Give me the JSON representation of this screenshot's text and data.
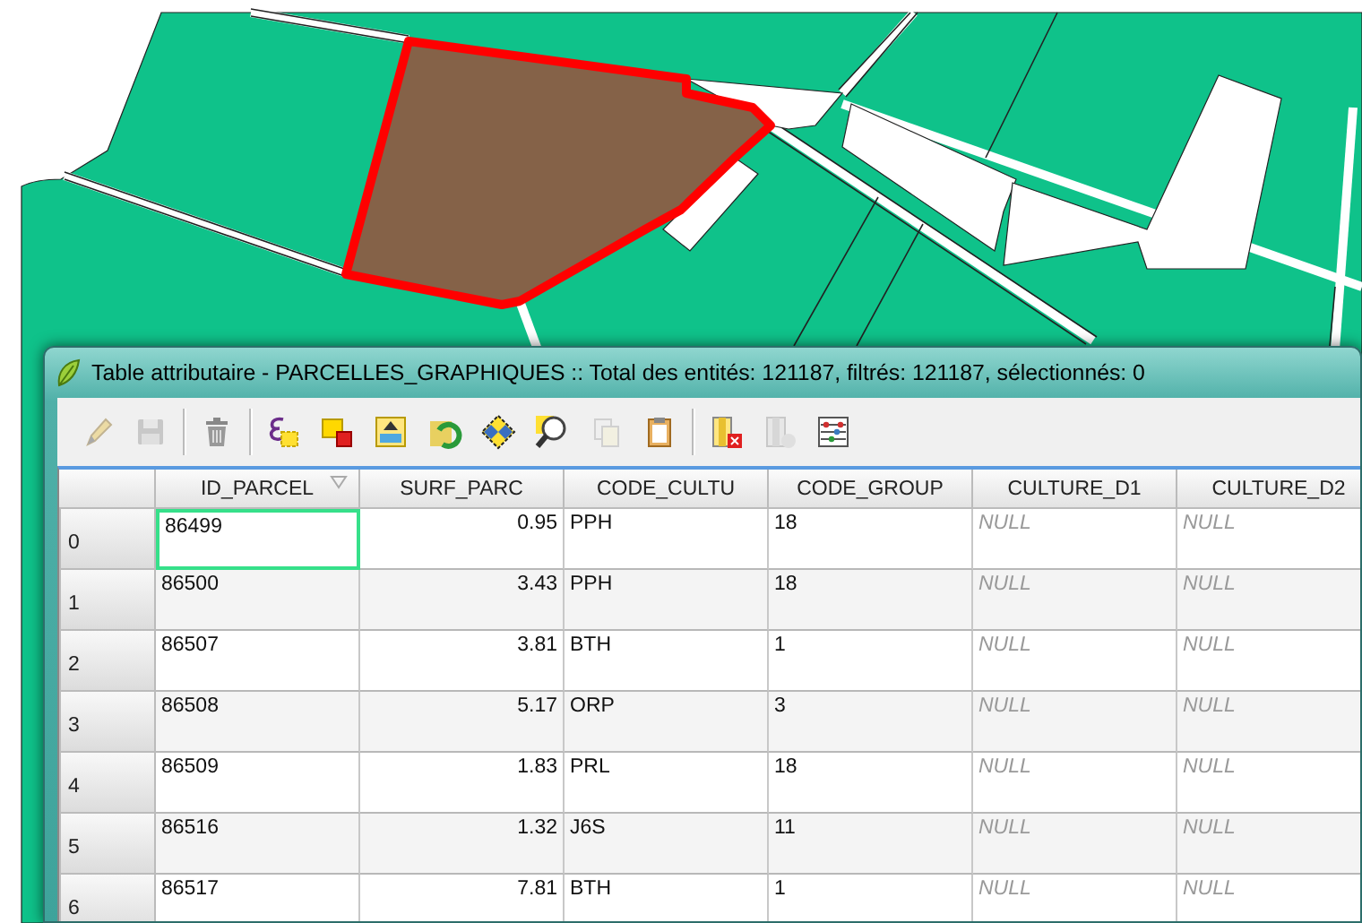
{
  "window": {
    "title": "Table attributaire - PARCELLES_GRAPHIQUES :: Total des entités: 121187, filtrés: 121187, sélectionnés: 0"
  },
  "toolbar": {
    "groups": [
      [
        {
          "kind": "pencil",
          "disabled": true
        },
        {
          "kind": "save",
          "disabled": true
        }
      ],
      [
        {
          "kind": "trash",
          "disabled": false
        }
      ],
      [
        {
          "kind": "expression",
          "disabled": false
        },
        {
          "kind": "deselect",
          "disabled": false
        },
        {
          "kind": "move-top",
          "disabled": false
        },
        {
          "kind": "invert",
          "disabled": false
        },
        {
          "kind": "pan",
          "disabled": false
        },
        {
          "kind": "zoom",
          "disabled": false
        },
        {
          "kind": "copy",
          "disabled": true
        },
        {
          "kind": "paste",
          "disabled": false
        }
      ],
      [
        {
          "kind": "delete-column",
          "disabled": false
        },
        {
          "kind": "new-column",
          "disabled": true
        },
        {
          "kind": "calculator",
          "disabled": false
        }
      ]
    ]
  },
  "table": {
    "columns": [
      {
        "label": "ID_PARCEL",
        "kind": "text",
        "sorted": true
      },
      {
        "label": "SURF_PARC",
        "kind": "numeric",
        "sorted": false
      },
      {
        "label": "CODE_CULTU",
        "kind": "text",
        "sorted": false
      },
      {
        "label": "CODE_GROUP",
        "kind": "text",
        "sorted": false
      },
      {
        "label": "CULTURE_D1",
        "kind": "text",
        "sorted": false
      },
      {
        "label": "CULTURE_D2",
        "kind": "text",
        "sorted": false
      }
    ],
    "rows": [
      {
        "header": "0",
        "focused": true,
        "cells": [
          {
            "text": "86499",
            "null": false
          },
          {
            "text": "0.95",
            "null": false
          },
          {
            "text": "PPH",
            "null": false
          },
          {
            "text": "18",
            "null": false
          },
          {
            "text": "NULL",
            "null": true
          },
          {
            "text": "NULL",
            "null": true
          }
        ]
      },
      {
        "header": "1",
        "focused": false,
        "cells": [
          {
            "text": "86500",
            "null": false
          },
          {
            "text": "3.43",
            "null": false
          },
          {
            "text": "PPH",
            "null": false
          },
          {
            "text": "18",
            "null": false
          },
          {
            "text": "NULL",
            "null": true
          },
          {
            "text": "NULL",
            "null": true
          }
        ]
      },
      {
        "header": "2",
        "focused": false,
        "cells": [
          {
            "text": "86507",
            "null": false
          },
          {
            "text": "3.81",
            "null": false
          },
          {
            "text": "BTH",
            "null": false
          },
          {
            "text": "1",
            "null": false
          },
          {
            "text": "NULL",
            "null": true
          },
          {
            "text": "NULL",
            "null": true
          }
        ]
      },
      {
        "header": "3",
        "focused": false,
        "cells": [
          {
            "text": "86508",
            "null": false
          },
          {
            "text": "5.17",
            "null": false
          },
          {
            "text": "ORP",
            "null": false
          },
          {
            "text": "3",
            "null": false
          },
          {
            "text": "NULL",
            "null": true
          },
          {
            "text": "NULL",
            "null": true
          }
        ]
      },
      {
        "header": "4",
        "focused": false,
        "cells": [
          {
            "text": "86509",
            "null": false
          },
          {
            "text": "1.83",
            "null": false
          },
          {
            "text": "PRL",
            "null": false
          },
          {
            "text": "18",
            "null": false
          },
          {
            "text": "NULL",
            "null": true
          },
          {
            "text": "NULL",
            "null": true
          }
        ]
      },
      {
        "header": "5",
        "focused": false,
        "cells": [
          {
            "text": "86516",
            "null": false
          },
          {
            "text": "1.32",
            "null": false
          },
          {
            "text": "J6S",
            "null": false
          },
          {
            "text": "11",
            "null": false
          },
          {
            "text": "NULL",
            "null": true
          },
          {
            "text": "NULL",
            "null": true
          }
        ]
      },
      {
        "header": "6",
        "focused": false,
        "cells": [
          {
            "text": "86517",
            "null": false
          },
          {
            "text": "7.81",
            "null": false
          },
          {
            "text": "BTH",
            "null": false
          },
          {
            "text": "1",
            "null": false
          },
          {
            "text": "NULL",
            "null": true
          },
          {
            "text": "NULL",
            "null": true
          }
        ]
      }
    ]
  }
}
